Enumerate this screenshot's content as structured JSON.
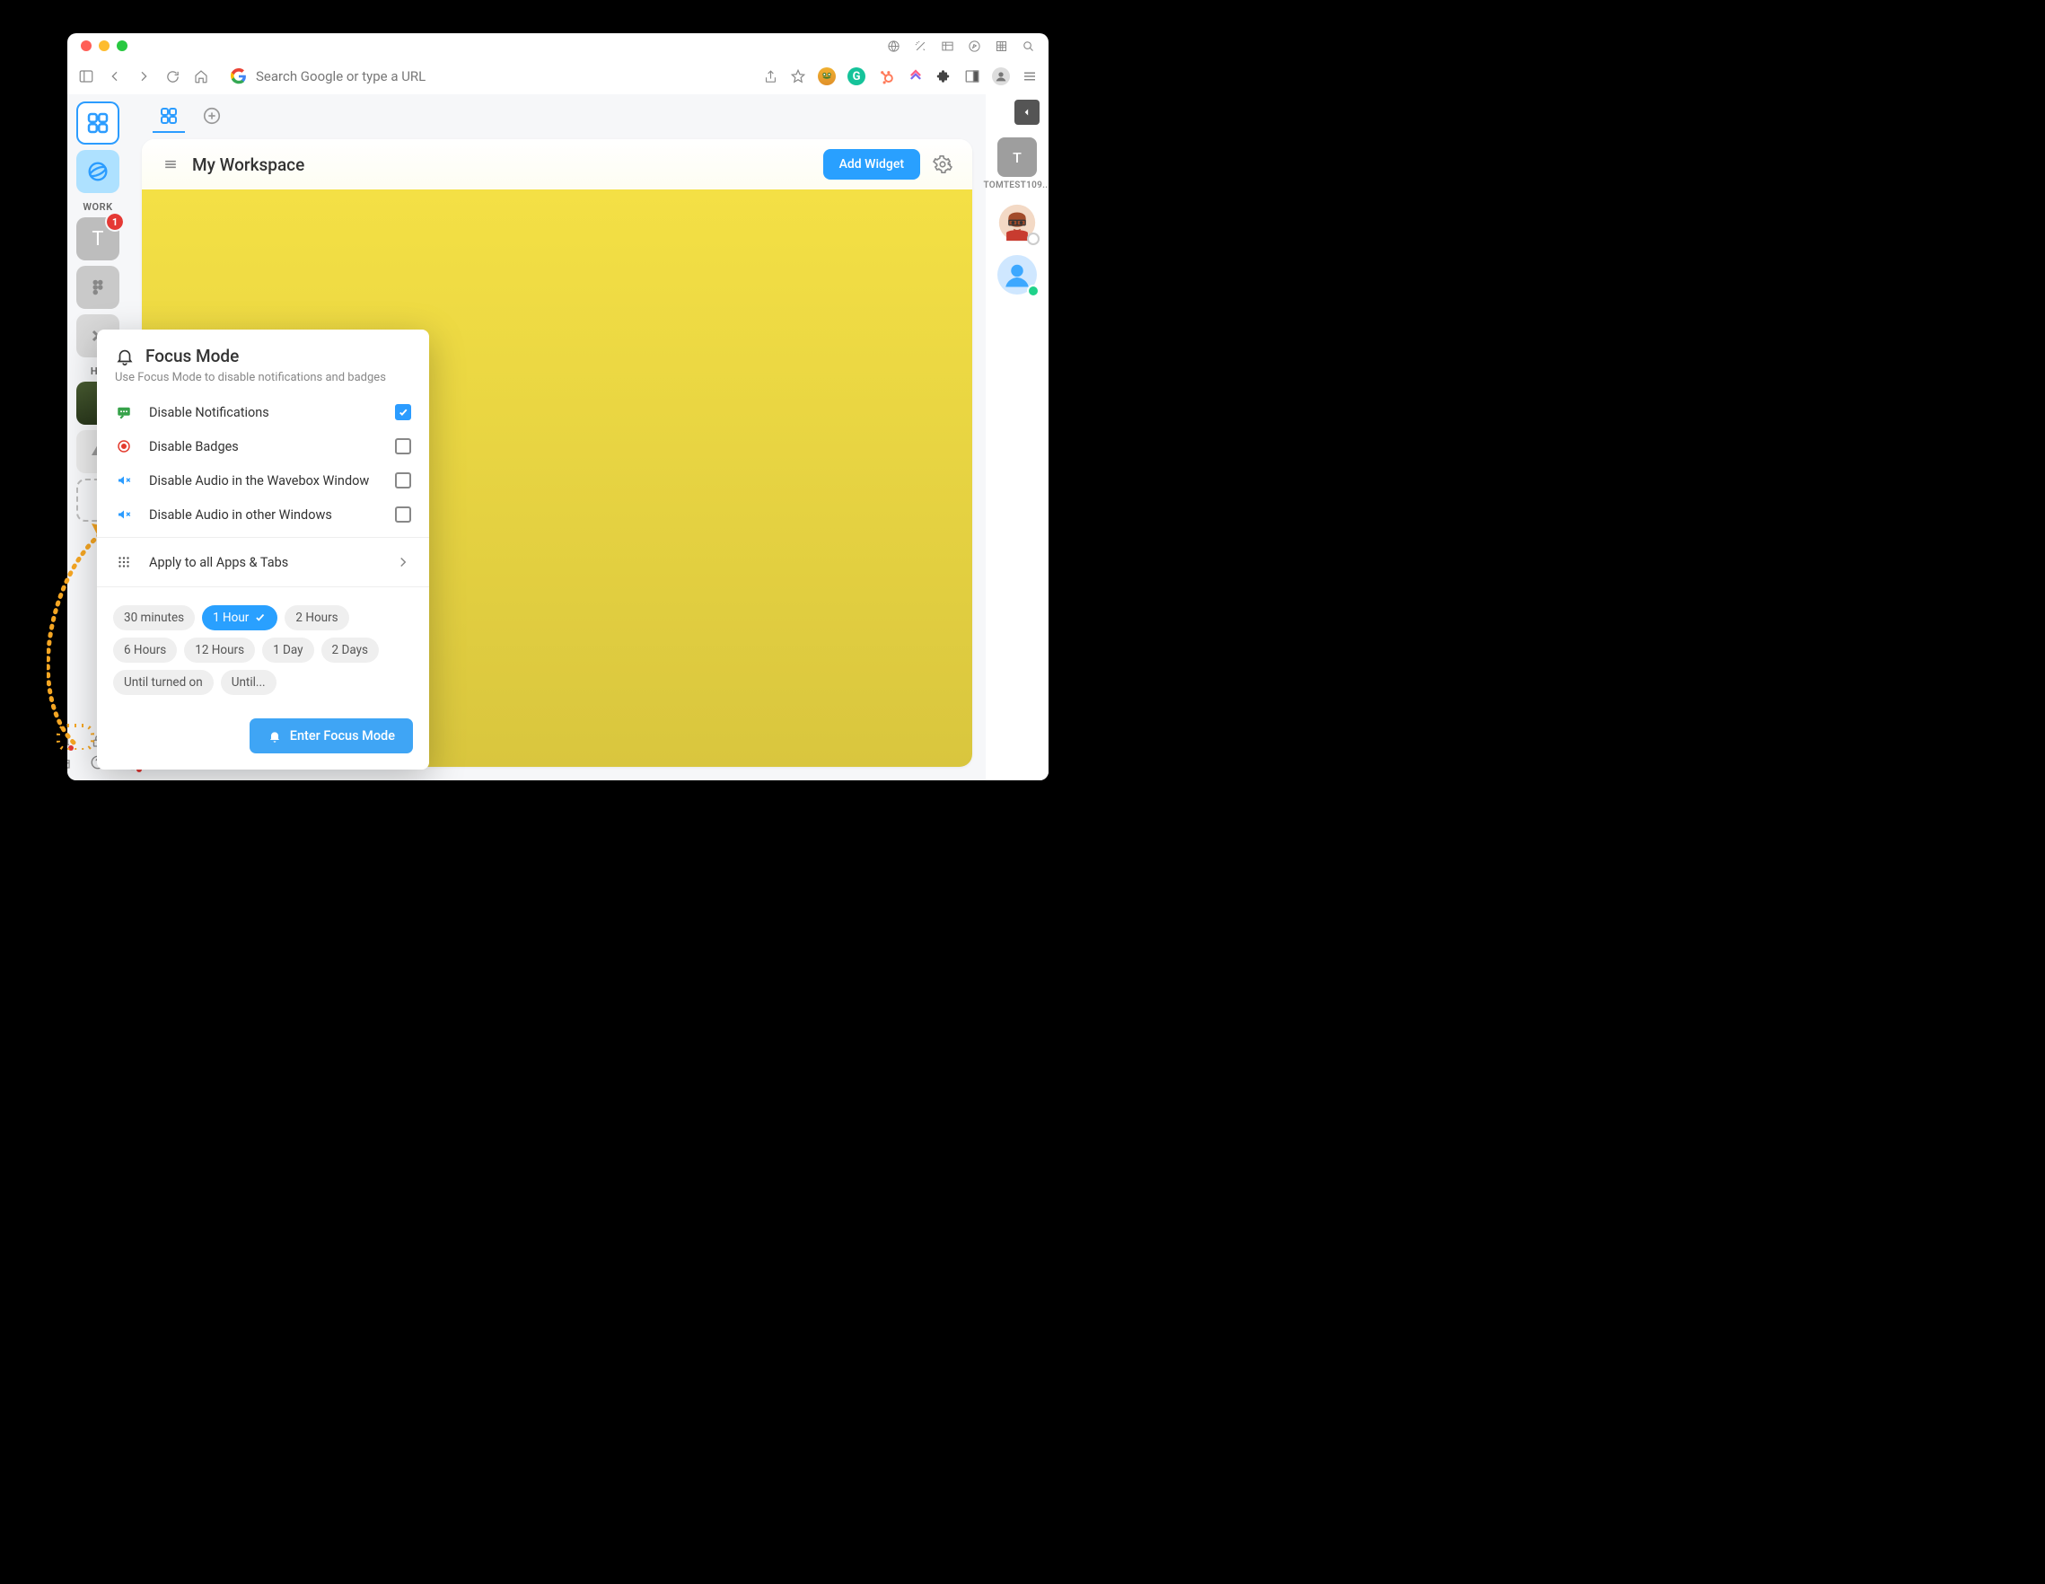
{
  "window": {
    "traffic": [
      "close",
      "min",
      "max"
    ],
    "titlebar_icons": [
      "globe",
      "wand",
      "table",
      "compass",
      "grid",
      "search"
    ]
  },
  "toolbar": {
    "url_placeholder": "Search Google or type a URL",
    "nav": [
      "sidebar-toggle",
      "back",
      "forward",
      "reload",
      "home"
    ],
    "extensions": [
      "share",
      "star",
      "frog",
      "grammarly",
      "hubspot",
      "clickup",
      "puzzle",
      "panel",
      "profile",
      "menu"
    ]
  },
  "sidebar": {
    "groups": [
      {
        "label": "WORK",
        "items": [
          {
            "name": "T",
            "badge": "1",
            "color": "#bdbdbd"
          },
          {
            "name": "figma",
            "color": "#bdbdbd"
          },
          {
            "name": "close",
            "color": "#d9d9d9"
          }
        ]
      },
      {
        "label": "HO",
        "items": [
          {
            "name": "photo",
            "color": "#3d4a2a"
          },
          {
            "name": "drive",
            "color": "#e9e9e9"
          }
        ]
      }
    ],
    "bottom": [
      "bell",
      "lock",
      "globe",
      "gift",
      "help",
      "settings"
    ]
  },
  "tabs": {
    "items": [
      "workspace",
      "add"
    ],
    "active": 0
  },
  "workspace": {
    "title": "My Workspace",
    "add_widget": "Add Widget"
  },
  "rightbar": {
    "collapse": true,
    "user1": {
      "letter": "T",
      "label": "TOMTEST109...",
      "color": "#9e9e9e"
    },
    "avatars": [
      {
        "name": "avatar-1",
        "presence": "#fff",
        "border": "#ccc",
        "color": "#e9b89a"
      },
      {
        "name": "avatar-2",
        "presence": "#1fd28a",
        "color": "#3da8ff"
      }
    ]
  },
  "focus": {
    "title": "Focus Mode",
    "subtitle": "Use Focus Mode to disable notifications and badges",
    "options": [
      {
        "label": "Disable Notifications",
        "icon": "chat",
        "iconColor": "#37a24a",
        "checked": true
      },
      {
        "label": "Disable Badges",
        "icon": "target",
        "iconColor": "#e33b2e",
        "checked": false
      },
      {
        "label": "Disable Audio in the Wavebox Window",
        "icon": "mute",
        "iconColor": "#2b9cff",
        "checked": false
      },
      {
        "label": "Disable Audio in other Windows",
        "icon": "mute",
        "iconColor": "#2b9cff",
        "checked": false
      }
    ],
    "apply_label": "Apply to all Apps & Tabs",
    "durations": [
      "30 minutes",
      "1 Hour",
      "2 Hours",
      "6 Hours",
      "12 Hours",
      "1 Day",
      "2 Days",
      "Until turned on",
      "Until..."
    ],
    "duration_selected": 1,
    "enter_label": "Enter Focus Mode"
  }
}
